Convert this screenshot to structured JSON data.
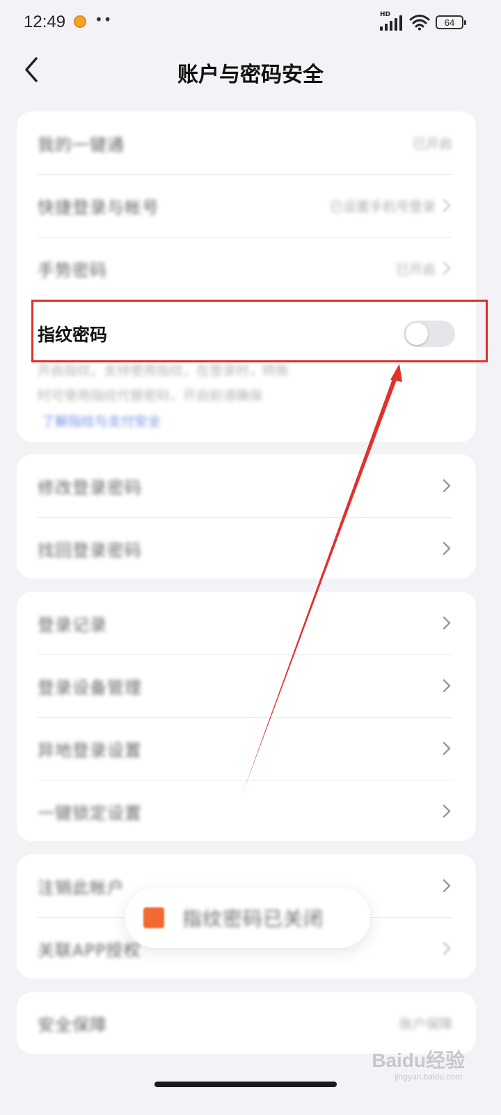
{
  "status_bar": {
    "time": "12:49",
    "dots": "••",
    "network_label": "HD",
    "battery": "64"
  },
  "header": {
    "title": "账户与密码安全",
    "back_icon": "chevron-left-icon"
  },
  "card1": {
    "rows": [
      {
        "label": "我的一键通",
        "value": "已开启"
      },
      {
        "label": "快捷登录与帐号",
        "value": "已设置手机号登录",
        "chevron": true
      },
      {
        "label": "手势密码",
        "value": "已开启",
        "chevron": true
      }
    ],
    "fingerprint": {
      "title": "指纹密码",
      "enabled": false,
      "desc_line1": "开启指纹，支持使用指纹，在登录时，转账",
      "desc_line2": "时可使用指纹代替密码，开启前请确保",
      "link": "了解指纹与支付安全"
    }
  },
  "card2": {
    "rows": [
      {
        "label": "修改登录密码"
      },
      {
        "label": "找回登录密码"
      }
    ]
  },
  "card3": {
    "rows": [
      {
        "label": "登录记录"
      },
      {
        "label": "登录设备管理"
      },
      {
        "label": "异地登录设置"
      },
      {
        "label": "一键锁定设置"
      }
    ]
  },
  "card4": {
    "rows": [
      {
        "label": "注销此帐户"
      },
      {
        "label": "关联APP授权"
      }
    ]
  },
  "card5": {
    "rows": [
      {
        "label": "安全保障",
        "value": "账户保障"
      }
    ]
  },
  "toast": {
    "text": "指纹密码已关闭"
  },
  "watermark": {
    "text": "Baidu经验",
    "sub": "jingyan.baidu.com"
  },
  "annotation_color": "#e0312b"
}
